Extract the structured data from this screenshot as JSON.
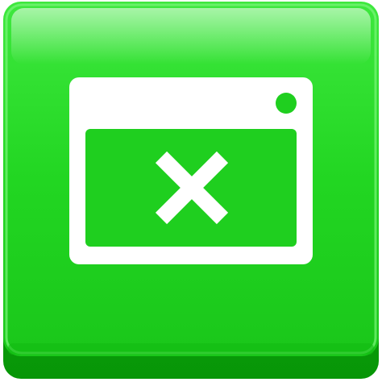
{
  "icon": {
    "name": "window-close-icon",
    "glyph": "close",
    "colors": {
      "button_green": "#1ed21e",
      "button_green_light": "#46ec46",
      "button_green_dark": "#0fb40f",
      "button_bevel": "#089808",
      "glyph_white": "#ffffff",
      "highlight": "#b8ffb8"
    }
  }
}
